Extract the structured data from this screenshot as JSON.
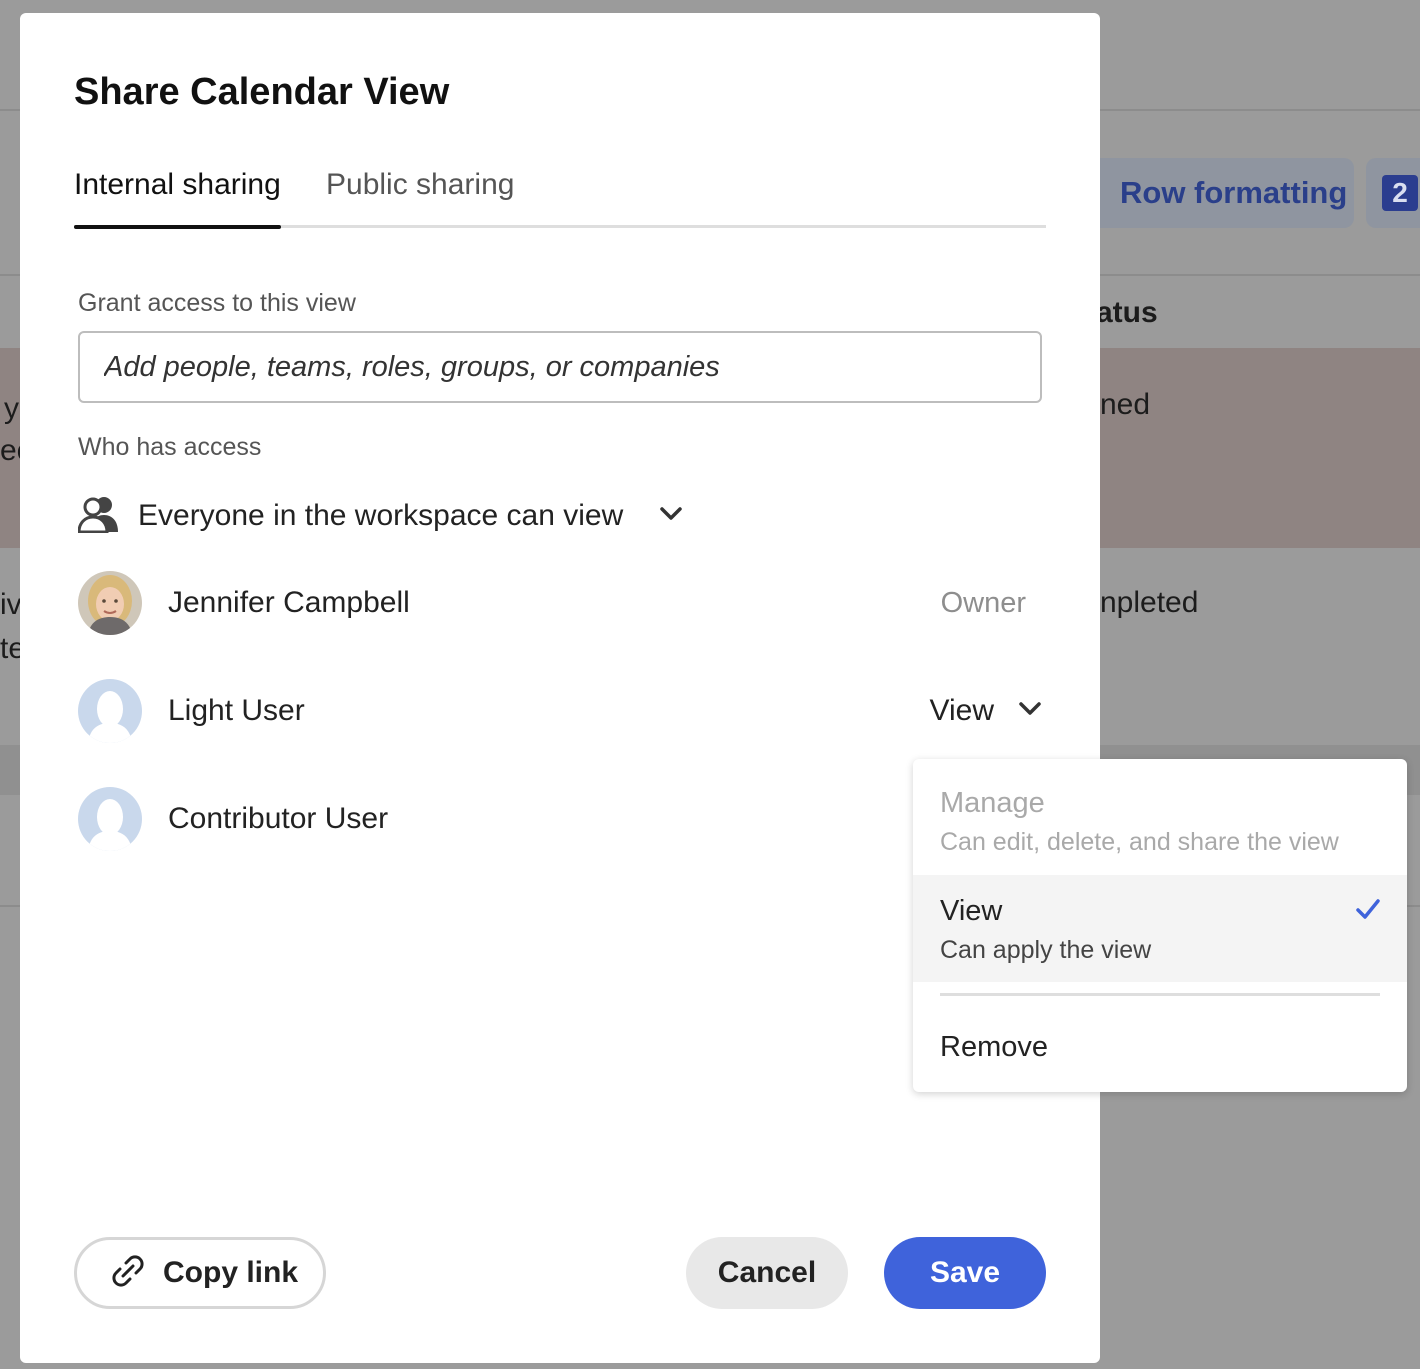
{
  "background": {
    "row_formatting_label": "Row formatting",
    "badge_count": "2",
    "status_header": "atus",
    "status_row1": "ned",
    "status_row2": "npleted",
    "left_fragments": [
      "y",
      "ec",
      "iv",
      "te"
    ]
  },
  "dialog": {
    "title": "Share Calendar View",
    "tabs": [
      {
        "label": "Internal sharing",
        "active": true
      },
      {
        "label": "Public sharing",
        "active": false
      }
    ],
    "grant_label": "Grant access to this view",
    "grant_placeholder": "Add people, teams, roles, groups, or companies",
    "who_label": "Who has access",
    "everyone_text": "Everyone in the workspace can view",
    "people": [
      {
        "name": "Jennifer Campbell",
        "role": "Owner"
      },
      {
        "name": "Light User",
        "role": "View"
      },
      {
        "name": "Contributor User",
        "role": ""
      }
    ],
    "copy_link_label": "Copy link",
    "cancel_label": "Cancel",
    "save_label": "Save"
  },
  "role_menu": {
    "options": [
      {
        "title": "Manage",
        "desc": "Can edit, delete, and share the view",
        "disabled": true
      },
      {
        "title": "View",
        "desc": "Can apply the view",
        "selected": true
      }
    ],
    "remove_label": "Remove"
  },
  "colors": {
    "primary": "#3f63db",
    "check": "#3f63db",
    "overlay": "#9b9b9b"
  }
}
